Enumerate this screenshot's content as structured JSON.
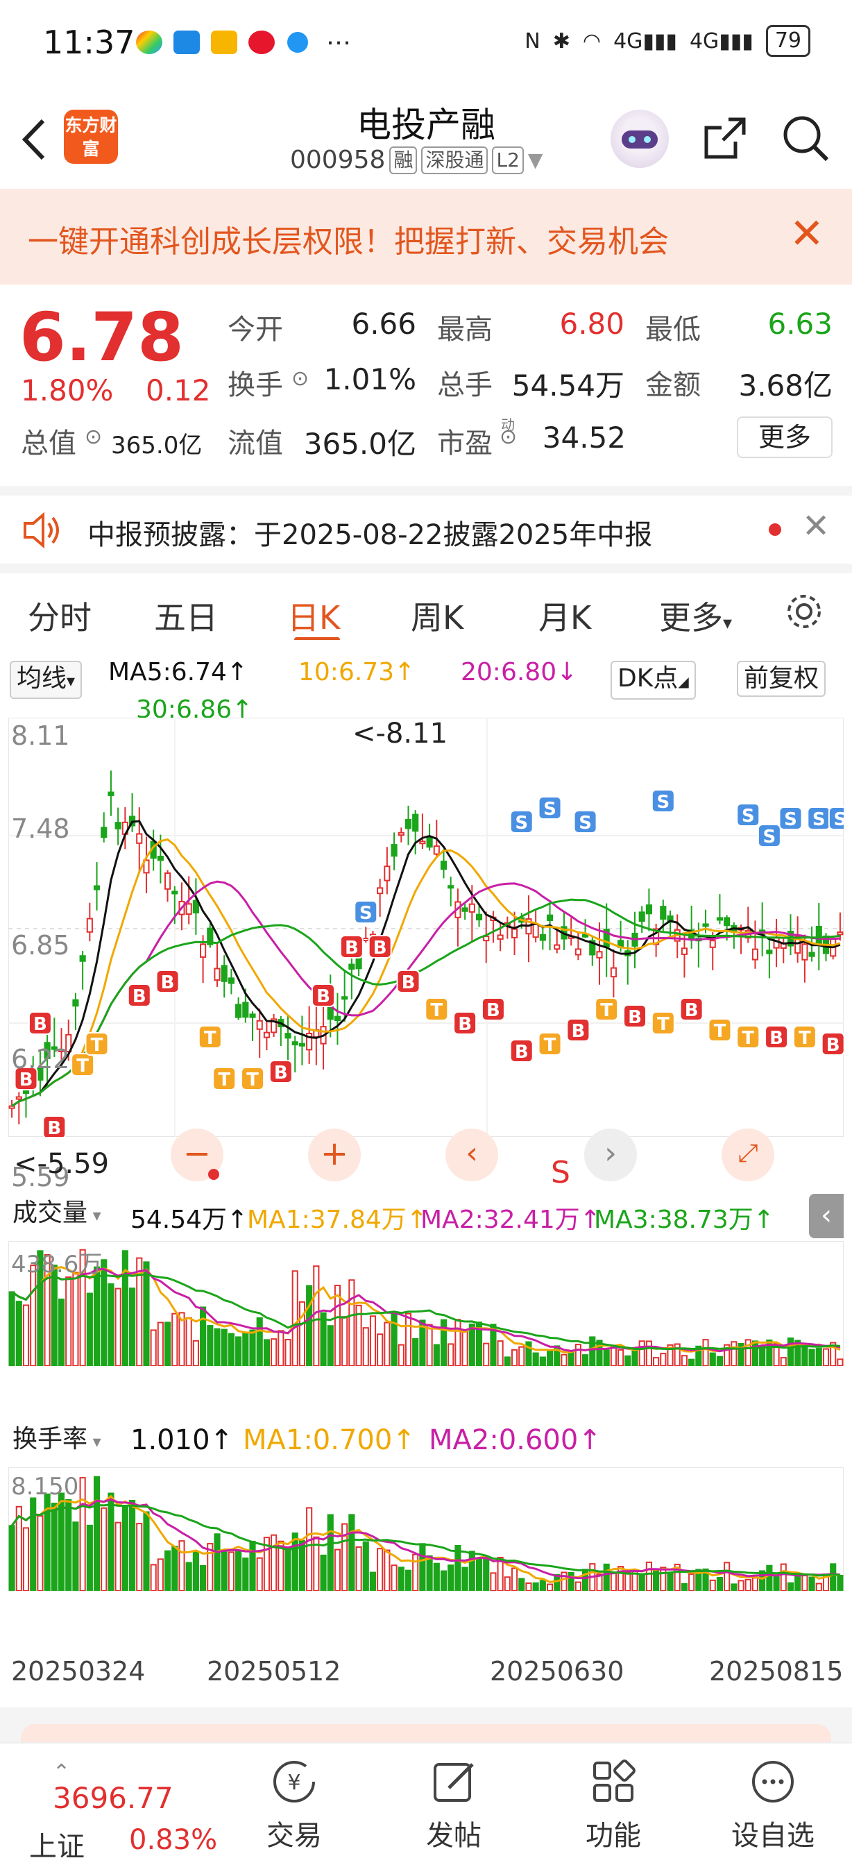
{
  "status_bar": {
    "time": "11:37",
    "signal_1": "4G",
    "signal_2": "4G",
    "battery": "79"
  },
  "header": {
    "logo_text": "东方财富",
    "stock_name": "电投产融",
    "stock_code": "000958",
    "tags": [
      "融",
      "深股通",
      "L2"
    ]
  },
  "banner": {
    "text": "一键开通科创成长层权限！把握打新、交易机会"
  },
  "quote": {
    "price": "6.78",
    "change_pct": "1.80%",
    "change_amt": "0.12",
    "rows": [
      [
        {
          "label": "今开",
          "value": "6.66"
        },
        {
          "label": "最高",
          "value": "6.80"
        },
        {
          "label": "最低",
          "value": "6.63"
        }
      ],
      [
        {
          "label": "换手",
          "value": "1.01%"
        },
        {
          "label": "总手",
          "value": "54.54万"
        },
        {
          "label": "金额",
          "value": "3.68亿"
        }
      ],
      [
        {
          "label": "总值",
          "value": "365.0亿"
        },
        {
          "label": "流值",
          "value": "365.0亿"
        },
        {
          "label": "市盈",
          "value": "34.52"
        }
      ]
    ],
    "pe_superscript": "动",
    "more": "更多"
  },
  "notice": {
    "text": "中报预披露：于2025-08-22披露2025年中报"
  },
  "tabs": [
    "分时",
    "五日",
    "日K",
    "周K",
    "月K",
    "更多"
  ],
  "active_tab": "日K",
  "kline": {
    "indicator": "均线",
    "ma5": "MA5:6.74↑",
    "ma10": "10:6.73↑",
    "ma20": "20:6.80↓",
    "ma30": "30:6.86↑",
    "dk_button": "DK点",
    "fq_button": "前复权",
    "y_ticks": [
      "8.11",
      "7.48",
      "6.85",
      "6.22",
      "5.59"
    ],
    "high_marker": "<-8.11",
    "low_marker": "<-5.59",
    "s_label": "S"
  },
  "volume": {
    "indicator": "成交量",
    "value": "54.54万↑",
    "ma1": "MA1:37.84万↑",
    "ma2": "MA2:32.41万↑",
    "ma3": "MA3:38.73万↑",
    "max_label": "438.6万"
  },
  "turnover": {
    "indicator": "换手率",
    "value": "1.010↑",
    "ma1": "MA1:0.700↑",
    "ma2": "MA2:0.600↑",
    "max_label": "8.150"
  },
  "x_dates": [
    "20250324",
    "20250512",
    "20250630",
    "20250815"
  ],
  "bottom_nav": {
    "index_value": "3696.77",
    "index_name": "上证",
    "index_change": "0.83%",
    "items": [
      "交易",
      "发帖",
      "功能",
      "设自选"
    ]
  },
  "colors": {
    "up": "#e22f2f",
    "down": "#1aa51a",
    "accent": "#e2561e",
    "ma5": "#111111",
    "ma10": "#f0a800",
    "ma20": "#c81fa5",
    "ma30": "#1aa51a"
  }
}
